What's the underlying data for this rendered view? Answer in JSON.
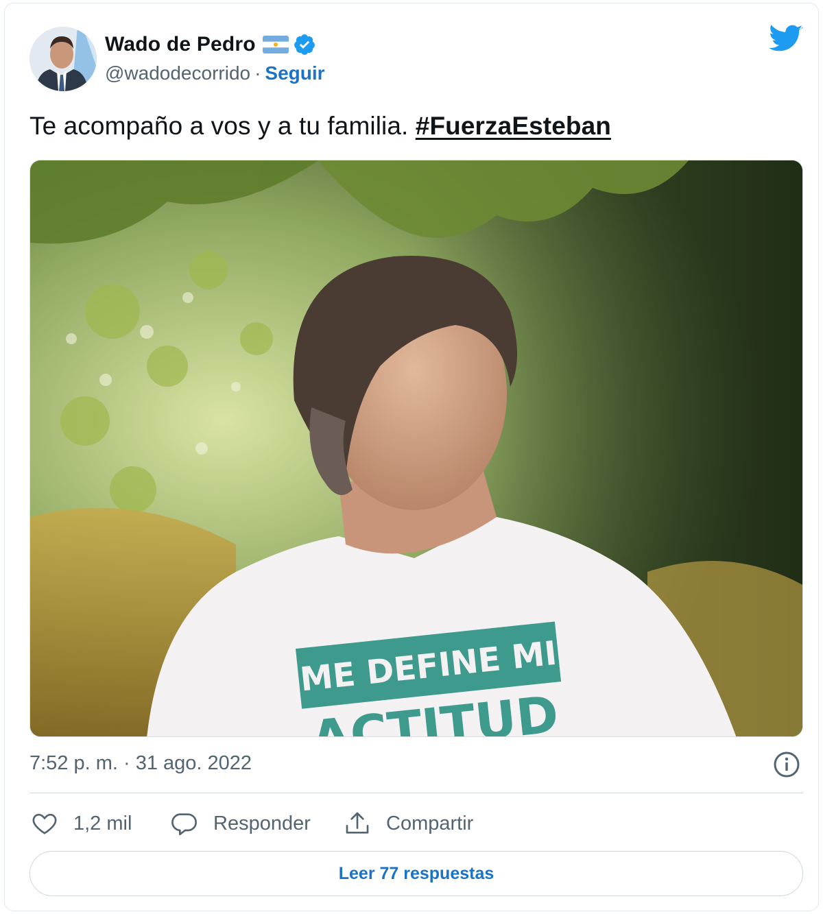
{
  "author": {
    "name": "Wado de Pedro",
    "handle": "@wadodecorrido",
    "separator": "·",
    "follow_label": "Seguir"
  },
  "tweet": {
    "text": "Te acompaño a vos y a tu familia. ",
    "hashtag": "#FuerzaEsteban"
  },
  "photo": {
    "shirt_line1": "ME DEFINE MI",
    "shirt_line2": "ACTITUD"
  },
  "meta": {
    "timestamp": "7:52 p. m. · 31 ago. 2022"
  },
  "actions": {
    "likes": "1,2 mil",
    "reply_label": "Responder",
    "share_label": "Compartir"
  },
  "footer": {
    "read_replies_label": "Leer 77 respuestas"
  },
  "colors": {
    "accent": "#1b73c8",
    "twitter_blue": "#1d9bf0",
    "muted": "#536471",
    "border": "#cfd9de"
  },
  "icons": [
    "twitter-bird-icon",
    "verified-badge-icon",
    "argentina-flag-icon",
    "info-icon",
    "heart-icon",
    "reply-bubble-icon",
    "share-icon"
  ]
}
